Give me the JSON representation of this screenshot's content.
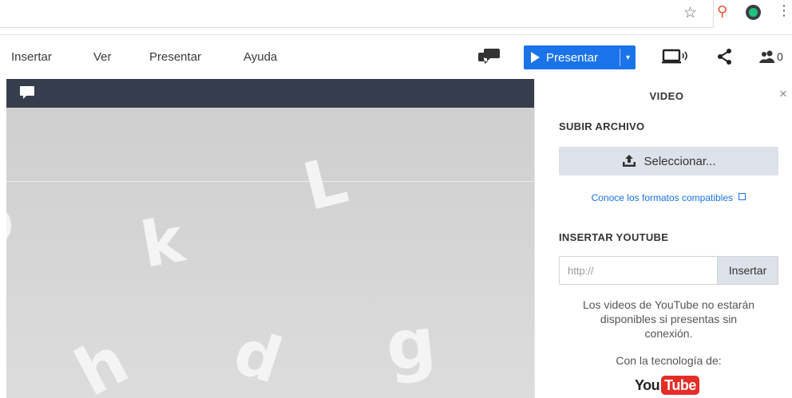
{
  "menu": {
    "items": [
      {
        "label": "Insertar"
      },
      {
        "label": "Ver"
      },
      {
        "label": "Presentar"
      },
      {
        "label": "Ayuda"
      }
    ]
  },
  "toolbar": {
    "present_label": "Presentar",
    "present_dropdown": "▾",
    "collaborators_count": "0"
  },
  "slide": {
    "letters": [
      "L",
      "k",
      "h",
      "d",
      "g"
    ]
  },
  "panel": {
    "title": "VIDEO",
    "close": "×",
    "upload_section": "SUBIR ARCHIVO",
    "select_label": "Seleccionar...",
    "formats_link": "Conoce los formatos compatibles",
    "youtube_section": "INSERTAR YOUTUBE",
    "youtube_placeholder": "http://",
    "insert_label": "Insertar",
    "offline_note": "Los videos de YouTube no estarán disponibles si presentas sin conexión.",
    "tech_label": "Con la tecnología de:",
    "logo_you": "You",
    "logo_tube": "Tube"
  },
  "colors": {
    "accent": "#1a73e8",
    "header_dark": "#363d4c",
    "youtube_red": "#e52d27"
  }
}
